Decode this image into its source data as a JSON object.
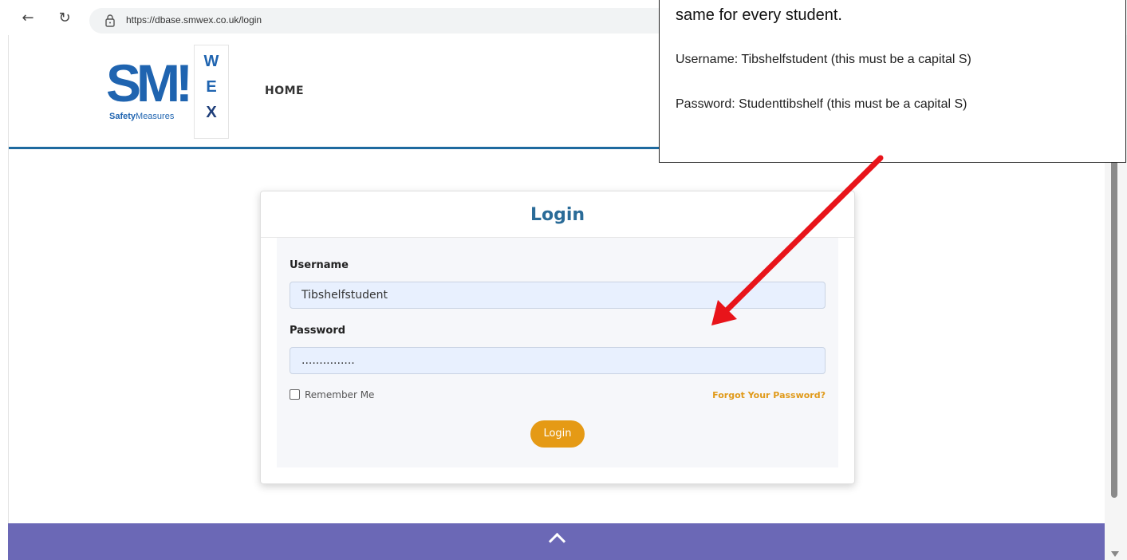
{
  "browser": {
    "url": "https://dbase.smwex.co.uk/login"
  },
  "header": {
    "logo": {
      "main_letters": "SM!",
      "tagline_bold": "Safety",
      "tagline_rest": "Measures",
      "side_letters": [
        "W",
        "E",
        "X"
      ]
    },
    "nav_home": "HOME"
  },
  "login": {
    "title": "Login",
    "username_label": "Username",
    "username_value": "Tibshelfstudent",
    "password_label": "Password",
    "password_value": "...............",
    "remember_label": "Remember Me",
    "forgot_label": "Forgot Your Password?",
    "submit_label": "Login"
  },
  "annotation": {
    "line1": "same for every student.",
    "line2": "Username: Tibshelfstudent (this must be a capital S)",
    "line3": "Password: Studenttibshelf (this must be a capital S)",
    "arrow_color": "#e8141a"
  },
  "colors": {
    "accent_blue": "#1e6a9f",
    "button_orange": "#e59a15",
    "footer_purple": "#6b68b6"
  }
}
